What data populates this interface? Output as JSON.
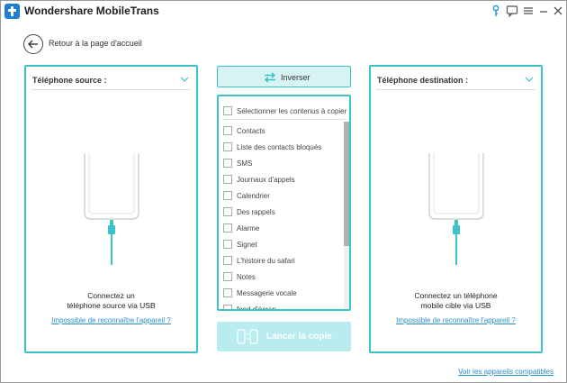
{
  "window": {
    "title": "Wondershare MobileTrans"
  },
  "titlebar_icons": [
    "key-icon",
    "feedback-icon",
    "menu-icon",
    "minimize-icon",
    "close-icon"
  ],
  "back": {
    "label": "Retour à la page d'accueil",
    "icon": "arrow-left-icon"
  },
  "source_panel": {
    "title": "Téléphone source :",
    "connect_line1": "Connectez un",
    "connect_line2": "téléphone source via USB",
    "link": "Impossible de reconnaître l'appareil ?"
  },
  "destination_panel": {
    "title": "Téléphone destination :",
    "connect_line1": "Connectez un téléphone",
    "connect_line2": "mobile cible via USB",
    "link": "Impossible de reconnaître l'appareil ?"
  },
  "invert_button": {
    "label": "Inverser",
    "icon": "swap-arrows-icon"
  },
  "content_list": {
    "select_all": "Sélectionner les contenus à copier :",
    "items": [
      "Contacts",
      "Liste des contacts bloqués",
      "SMS",
      "Journaux d'appels",
      "Calendrier",
      "Des rappels",
      "Alarme",
      "Signet",
      "L'histoire du safari",
      "Notes",
      "Messagerie vocale",
      "fond d'écran"
    ]
  },
  "start_button": {
    "label": "Lancer la copie",
    "icon": "phones-transfer-icon"
  },
  "footer": {
    "compat_link": "Voir les appareils compatibles"
  },
  "colors": {
    "accent": "#3cc3c8",
    "link": "#2a8ec8",
    "start_bg": "#b9ecef",
    "invert_bg": "#d8f3f4",
    "logo": "#1e7fd0"
  }
}
